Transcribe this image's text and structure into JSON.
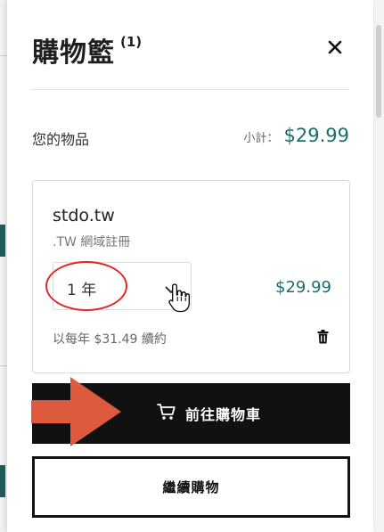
{
  "cart": {
    "title": "購物籃",
    "count": "(1)",
    "items_label": "您的物品",
    "subtotal_label": "小計：",
    "subtotal_value": "$29.99"
  },
  "item": {
    "domain": "stdo.tw",
    "type": ".TW 網域註冊",
    "term": "1 年",
    "price": "$29.99",
    "renewal": "以每年 $31.49 續約"
  },
  "buttons": {
    "checkout": "前往購物車",
    "continue": "繼續購物"
  },
  "icons": {
    "close": "close-icon",
    "dropdown": "chevron-down-icon",
    "delete": "trash-icon",
    "cart": "cart-icon",
    "cursor": "hand-cursor-icon",
    "annotation_arrow": "arrow-right-icon"
  },
  "colors": {
    "accent": "#1b6e6b",
    "button_dark": "#111111",
    "annotation_red": "#e32626",
    "annotation_arrow": "#dd5a3c"
  }
}
